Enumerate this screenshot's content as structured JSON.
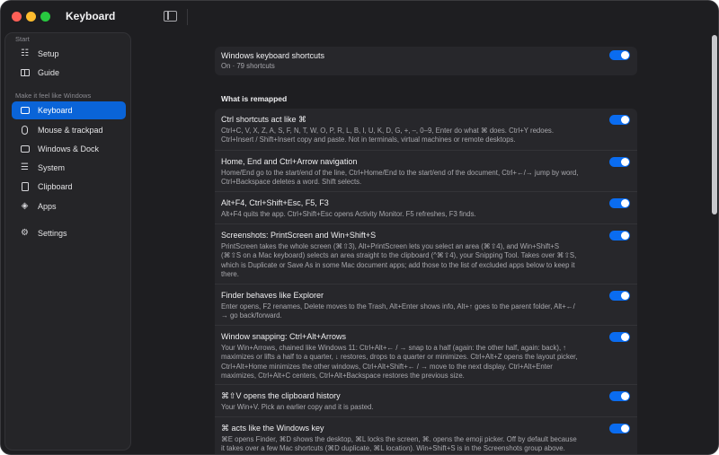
{
  "window": {
    "title": "Keyboard"
  },
  "sidebar": {
    "sections": [
      {
        "label": "Start"
      },
      {
        "label": "Make it feel like Windows"
      }
    ],
    "items": [
      {
        "label": "Setup",
        "icon": "setup-icon"
      },
      {
        "label": "Guide",
        "icon": "book-icon"
      },
      {
        "label": "Keyboard",
        "icon": "keyboard-icon",
        "active": true
      },
      {
        "label": "Mouse & trackpad",
        "icon": "mouse-icon"
      },
      {
        "label": "Windows & Dock",
        "icon": "windows-icon"
      },
      {
        "label": "System",
        "icon": "system-icon"
      },
      {
        "label": "Clipboard",
        "icon": "clipboard-icon"
      },
      {
        "label": "Apps",
        "icon": "apps-icon"
      },
      {
        "label": "Settings",
        "icon": "gear-icon"
      }
    ]
  },
  "main": {
    "master": {
      "title": "Windows keyboard shortcuts",
      "subtitle": "On · 79 shortcuts",
      "enabled": true
    },
    "remapped_heading": "What is remapped",
    "rows": [
      {
        "title": "Ctrl shortcuts act like ⌘",
        "desc": "Ctrl+C, V, X, Z, A, S, F, N, T, W, O, P, R, L, B, I, U, K, D, G, +, –, 0–9, Enter do what ⌘ does. Ctrl+Y redoes. Ctrl+Insert / Shift+Insert copy and paste. Not in terminals, virtual machines or remote desktops.",
        "enabled": true
      },
      {
        "title": "Home, End and Ctrl+Arrow navigation",
        "desc": "Home/End go to the start/end of the line, Ctrl+Home/End to the start/end of the document, Ctrl+←/→ jump by word, Ctrl+Backspace deletes a word. Shift selects.",
        "enabled": true
      },
      {
        "title": "Alt+F4, Ctrl+Shift+Esc, F5, F3",
        "desc": "Alt+F4 quits the app. Ctrl+Shift+Esc opens Activity Monitor. F5 refreshes, F3 finds.",
        "enabled": true
      },
      {
        "title": "Screenshots: PrintScreen and Win+Shift+S",
        "desc": "PrintScreen takes the whole screen (⌘⇧3), Alt+PrintScreen lets you select an area (⌘⇧4), and Win+Shift+S (⌘⇧S on a Mac keyboard) selects an area straight to the clipboard (^⌘⇧4), your Snipping Tool. Takes over ⌘⇧S, which is Duplicate or Save As in some Mac document apps; add those to the list of excluded apps below to keep it there.",
        "enabled": true
      },
      {
        "title": "Finder behaves like Explorer",
        "desc": "Enter opens, F2 renames, Delete moves to the Trash, Alt+Enter shows info, Alt+↑ goes to the parent folder, Alt+←/→ go back/forward.",
        "enabled": true
      },
      {
        "title": "Window snapping: Ctrl+Alt+Arrows",
        "desc": "Your Win+Arrows, chained like Windows 11: Ctrl+Alt+← / → snap to a half (again: the other half, again: back), ↑ maximizes or lifts a half to a quarter, ↓ restores, drops to a quarter or minimizes. Ctrl+Alt+Z opens the layout picker, Ctrl+Alt+Home minimizes the other windows, Ctrl+Alt+Shift+← / → move to the next display. Ctrl+Alt+Enter maximizes, Ctrl+Alt+C centers, Ctrl+Alt+Backspace restores the previous size.",
        "enabled": true
      },
      {
        "title": "⌘⇧V opens the clipboard history",
        "desc": "Your Win+V. Pick an earlier copy and it is pasted.",
        "enabled": true
      },
      {
        "title": "⌘ acts like the Windows key",
        "desc": "⌘E opens Finder, ⌘D shows the desktop, ⌘L locks the screen, ⌘. opens the emoji picker. Off by default because it takes over a few Mac shortcuts (⌘D duplicate, ⌘L location). Win+Shift+S is in the Screenshots group above.",
        "enabled": true
      }
    ]
  },
  "colors": {
    "accent": "#0a64d8",
    "toggle_on": "#0a6cf0",
    "window_bg": "#1e1e21",
    "card_bg": "#27272b"
  }
}
